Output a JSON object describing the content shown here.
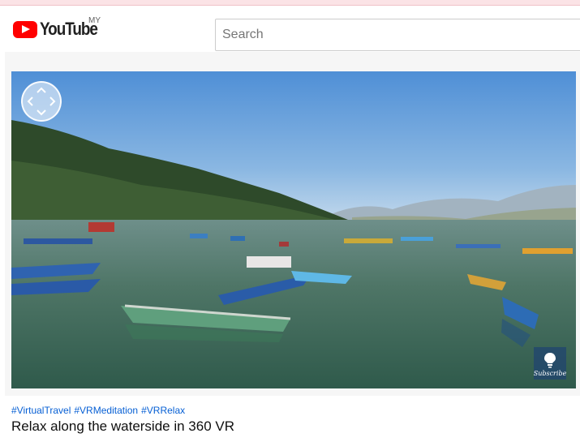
{
  "header": {
    "logo_text": "YouTube",
    "region": "MY",
    "search_placeholder": "Search"
  },
  "player": {
    "nav_control_icon": "vr-direction-pad-icon",
    "subscribe_label": "Subscribe",
    "subscribe_icon": "lightbulb-icon"
  },
  "video": {
    "hashtags": [
      "#VirtualTravel",
      "#VRMeditation",
      "#VRRelax"
    ],
    "title": "Relax along the waterside in 360 VR"
  },
  "colors": {
    "brand_red": "#ff0000",
    "link_blue": "#065fd4",
    "sky": "#6fa3da",
    "lake": "#4f7668"
  }
}
